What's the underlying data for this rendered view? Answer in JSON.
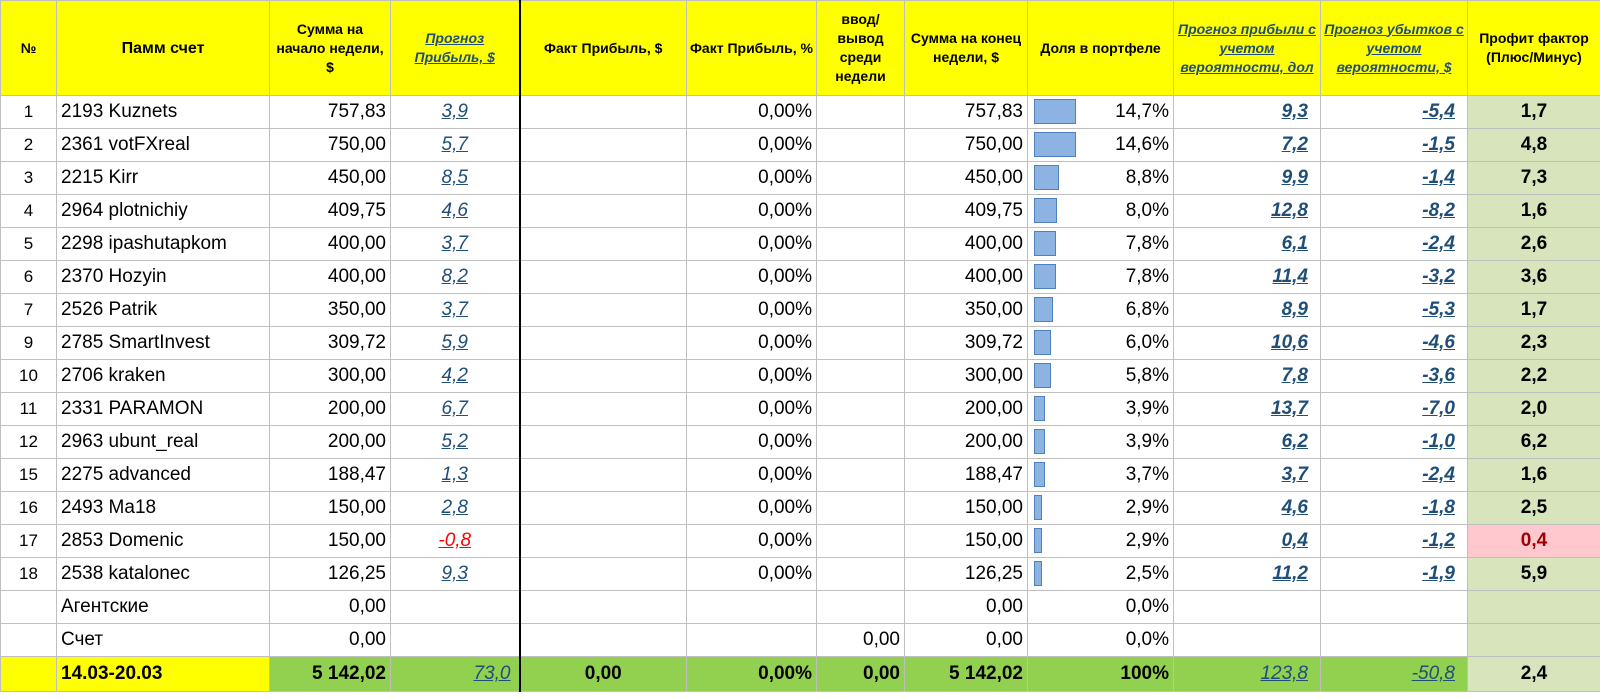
{
  "colors": {
    "header_bg": "#ffff00",
    "footer_bg": "#92d050",
    "pf_bg": "#d8e4bc",
    "pf_bad_bg": "#ffc7ce",
    "bar": "#8db3e2",
    "link": "#1f4e79",
    "negative": "#ff0000"
  },
  "headers": {
    "num": "№",
    "account": "Памм счет",
    "start_sum": "Сумма на начало недели, $",
    "forecast_profit": "Прогноз Прибыль, $",
    "fact_profit_usd": "Факт Прибыль, $",
    "fact_profit_pct": "Факт Прибыль, %",
    "deposit_withdraw": "ввод/ вывод среди недели",
    "end_sum": "Сумма на конец недели, $",
    "portfolio_share": "Доля в портфеле",
    "forecast_profit_prob": "Прогноз прибыли с учетом вероятности, дол",
    "forecast_loss_prob": "Прогноз убытков с учетом вероятности, $",
    "profit_factor": "Профит фактор (Плюс/Минус)"
  },
  "rows": [
    {
      "num": "1",
      "account": "2193 Kuznets",
      "start": "757,83",
      "forecast": "3,9",
      "fact_usd": "",
      "fact_pct": "0,00%",
      "io": "",
      "end": "757,83",
      "share": "14,7%",
      "share_frac": 0.147,
      "fprob": "9,3",
      "lprob": "-5,4",
      "pf": "1,7"
    },
    {
      "num": "2",
      "account": "2361 votFXreal",
      "start": "750,00",
      "forecast": "5,7",
      "fact_usd": "",
      "fact_pct": "0,00%",
      "io": "",
      "end": "750,00",
      "share": "14,6%",
      "share_frac": 0.146,
      "fprob": "7,2",
      "lprob": "-1,5",
      "pf": "4,8"
    },
    {
      "num": "3",
      "account": "2215 Kirr",
      "start": "450,00",
      "forecast": "8,5",
      "fact_usd": "",
      "fact_pct": "0,00%",
      "io": "",
      "end": "450,00",
      "share": "8,8%",
      "share_frac": 0.088,
      "fprob": "9,9",
      "lprob": "-1,4",
      "pf": "7,3"
    },
    {
      "num": "4",
      "account": "2964 plotnichiy",
      "start": "409,75",
      "forecast": "4,6",
      "fact_usd": "",
      "fact_pct": "0,00%",
      "io": "",
      "end": "409,75",
      "share": "8,0%",
      "share_frac": 0.08,
      "fprob": "12,8",
      "lprob": "-8,2",
      "pf": "1,6"
    },
    {
      "num": "5",
      "account": "2298 ipashutapkom",
      "start": "400,00",
      "forecast": "3,7",
      "fact_usd": "",
      "fact_pct": "0,00%",
      "io": "",
      "end": "400,00",
      "share": "7,8%",
      "share_frac": 0.078,
      "fprob": "6,1",
      "lprob": "-2,4",
      "pf": "2,6"
    },
    {
      "num": "6",
      "account": "2370 Hozyin",
      "start": "400,00",
      "forecast": "8,2",
      "fact_usd": "",
      "fact_pct": "0,00%",
      "io": "",
      "end": "400,00",
      "share": "7,8%",
      "share_frac": 0.078,
      "fprob": "11,4",
      "lprob": "-3,2",
      "pf": "3,6"
    },
    {
      "num": "7",
      "account": "2526 Patrik",
      "start": "350,00",
      "forecast": "3,7",
      "fact_usd": "",
      "fact_pct": "0,00%",
      "io": "",
      "end": "350,00",
      "share": "6,8%",
      "share_frac": 0.068,
      "fprob": "8,9",
      "lprob": "-5,3",
      "pf": "1,7"
    },
    {
      "num": "9",
      "account": "2785 SmartInvest",
      "start": "309,72",
      "forecast": "5,9",
      "fact_usd": "",
      "fact_pct": "0,00%",
      "io": "",
      "end": "309,72",
      "share": "6,0%",
      "share_frac": 0.06,
      "fprob": "10,6",
      "lprob": "-4,6",
      "pf": "2,3"
    },
    {
      "num": "10",
      "account": "2706 kraken",
      "start": "300,00",
      "forecast": "4,2",
      "fact_usd": "",
      "fact_pct": "0,00%",
      "io": "",
      "end": "300,00",
      "share": "5,8%",
      "share_frac": 0.058,
      "fprob": "7,8",
      "lprob": "-3,6",
      "pf": "2,2"
    },
    {
      "num": "11",
      "account": "2331 PARAMON",
      "start": "200,00",
      "forecast": "6,7",
      "fact_usd": "",
      "fact_pct": "0,00%",
      "io": "",
      "end": "200,00",
      "share": "3,9%",
      "share_frac": 0.039,
      "fprob": "13,7",
      "lprob": "-7,0",
      "pf": "2,0"
    },
    {
      "num": "12",
      "account": "2963 ubunt_real",
      "start": "200,00",
      "forecast": "5,2",
      "fact_usd": "",
      "fact_pct": "0,00%",
      "io": "",
      "end": "200,00",
      "share": "3,9%",
      "share_frac": 0.039,
      "fprob": "6,2",
      "lprob": "-1,0",
      "pf": "6,2"
    },
    {
      "num": "15",
      "account": "2275 advanced",
      "start": "188,47",
      "forecast": "1,3",
      "fact_usd": "",
      "fact_pct": "0,00%",
      "io": "",
      "end": "188,47",
      "share": "3,7%",
      "share_frac": 0.037,
      "fprob": "3,7",
      "lprob": "-2,4",
      "pf": "1,6"
    },
    {
      "num": "16",
      "account": "2493 Ma18",
      "start": "150,00",
      "forecast": "2,8",
      "fact_usd": "",
      "fact_pct": "0,00%",
      "io": "",
      "end": "150,00",
      "share": "2,9%",
      "share_frac": 0.029,
      "fprob": "4,6",
      "lprob": "-1,8",
      "pf": "2,5"
    },
    {
      "num": "17",
      "account": "2853 Domenic",
      "start": "150,00",
      "forecast": "-0,8",
      "fact_usd": "",
      "fact_pct": "0,00%",
      "io": "",
      "end": "150,00",
      "share": "2,9%",
      "share_frac": 0.029,
      "fprob": "0,4",
      "lprob": "-1,2",
      "pf": "0,4"
    },
    {
      "num": "18",
      "account": "2538 katalonec",
      "start": "126,25",
      "forecast": "9,3",
      "fact_usd": "",
      "fact_pct": "0,00%",
      "io": "",
      "end": "126,25",
      "share": "2,5%",
      "share_frac": 0.025,
      "fprob": "11,2",
      "lprob": "-1,9",
      "pf": "5,9"
    },
    {
      "num": "",
      "account": "Агентские",
      "start": "0,00",
      "forecast": "",
      "fact_usd": "",
      "fact_pct": "",
      "io": "",
      "end": "0,00",
      "share": "0,0%",
      "share_frac": 0,
      "fprob": "",
      "lprob": "",
      "pf": ""
    },
    {
      "num": "",
      "account": "Счет",
      "start": "0,00",
      "forecast": "",
      "fact_usd": "",
      "fact_pct": "",
      "io": "0,00",
      "end": "0,00",
      "share": "0,0%",
      "share_frac": 0,
      "fprob": "",
      "lprob": "",
      "pf": ""
    }
  ],
  "total": {
    "period": "14.03-20.03",
    "start": "5 142,02",
    "forecast": "73,0",
    "fact_usd": "0,00",
    "fact_pct": "0,00%",
    "io": "0,00",
    "end": "5 142,02",
    "share": "100%",
    "fprob": "123,8",
    "lprob": "-50,8",
    "pf": "2,4"
  }
}
